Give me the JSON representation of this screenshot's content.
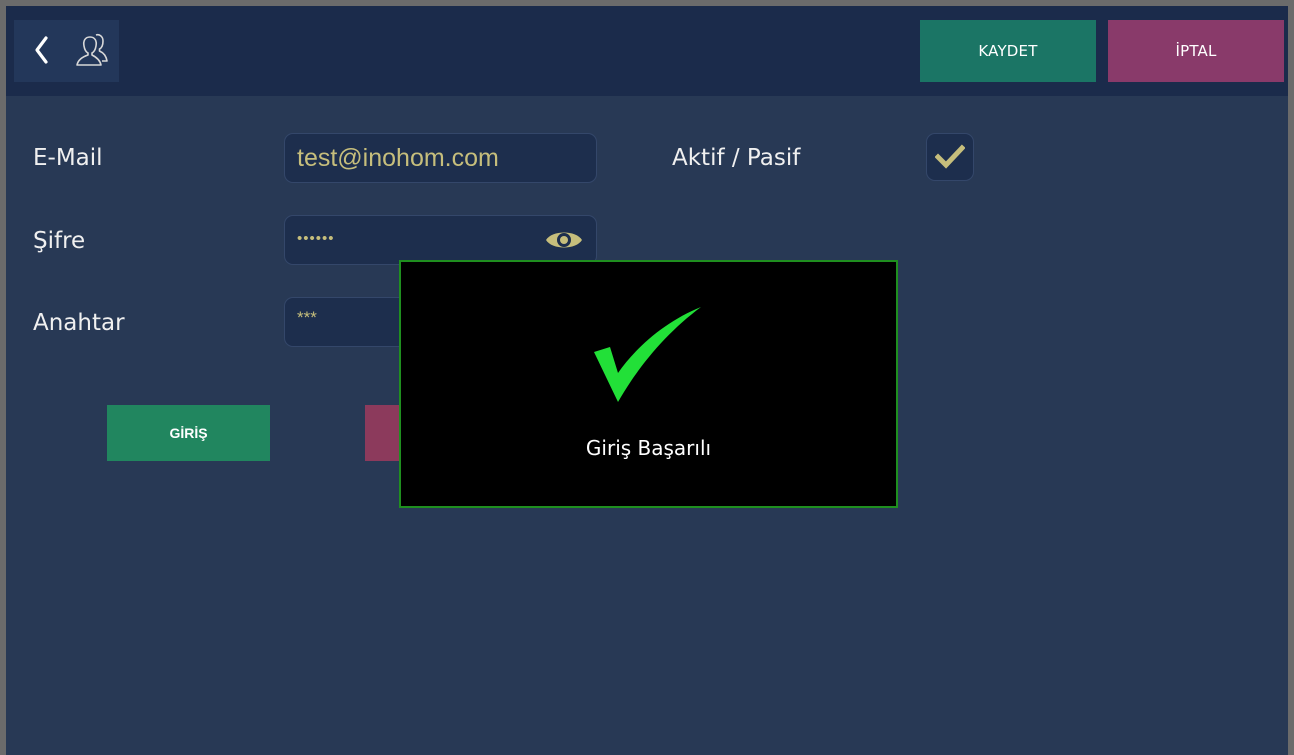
{
  "header": {
    "back_icon": "chevron-left-icon",
    "users_icon": "users-icon",
    "save_label": "KAYDET",
    "cancel_label": "İPTAL"
  },
  "form": {
    "email": {
      "label": "E-Mail",
      "value": "test@inohom.com"
    },
    "password": {
      "label": "Şifre",
      "value": "••••••",
      "toggle_icon": "eye-icon"
    },
    "key": {
      "label": "Anahtar",
      "value": "***"
    },
    "active": {
      "label": "Aktif / Pasif",
      "checked": true
    }
  },
  "actions": {
    "login_label": "GİRİŞ"
  },
  "dialog": {
    "icon": "checkmark-icon",
    "message": "Giriş Başarılı"
  },
  "colors": {
    "background": "#283955",
    "topbar": "#1b2b4b",
    "save": "#1b7565",
    "cancel": "#893a6a",
    "login": "#21865f",
    "field_text": "#c6be7c",
    "dialog_border": "#1f8f1f",
    "success_check": "#22e038"
  }
}
